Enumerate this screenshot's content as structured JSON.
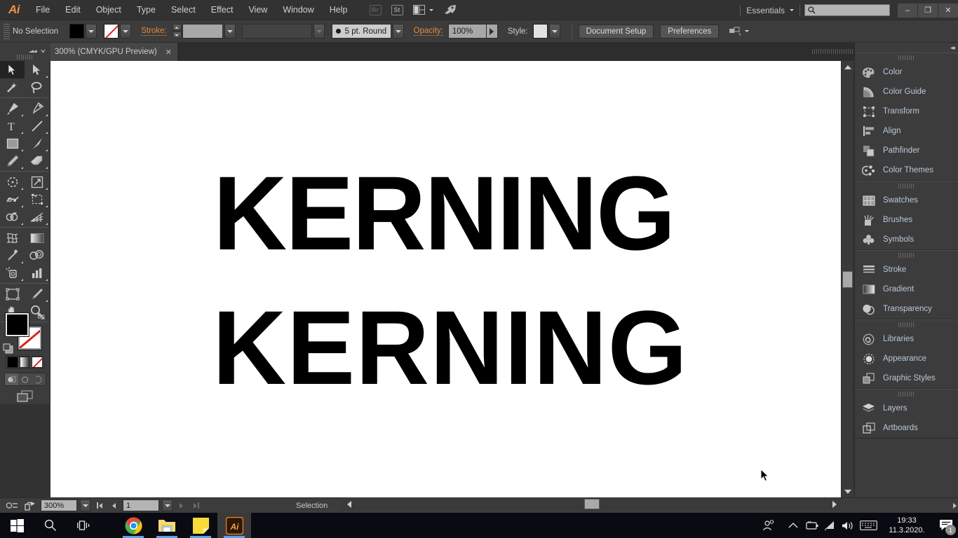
{
  "app": {
    "name": "Adobe Illustrator",
    "logo_text": "Ai",
    "accent_orange": "#e08b3e",
    "dock_label_color": "#b9c8d8"
  },
  "menubar": {
    "items": [
      "File",
      "Edit",
      "Object",
      "Type",
      "Select",
      "Effect",
      "View",
      "Window",
      "Help"
    ],
    "icons": [
      {
        "name": "bridge-icon",
        "label": "Br"
      },
      {
        "name": "stock-icon",
        "label": "St"
      },
      {
        "name": "arrange-documents-icon",
        "label": ""
      },
      {
        "name": "rocket-icon",
        "label": ""
      }
    ],
    "workspace": "Essentials",
    "search_placeholder": "",
    "window_buttons": {
      "minimize": "–",
      "restore": "❐",
      "close": "✕"
    }
  },
  "controlbar": {
    "selection_status": "No Selection",
    "fill_swatch": "#000000",
    "stroke_swatch": "none",
    "stroke_label": "Stroke:",
    "stroke_weight": "",
    "stroke_profile": "",
    "brush_definition": "5 pt. Round",
    "opacity_label": "Opacity:",
    "opacity_value": "100%",
    "style_label": "Style:",
    "document_setup_label": "Document Setup",
    "preferences_label": "Preferences"
  },
  "tabbar": {
    "document_title": "300% (CMYK/GPU Preview)",
    "close_glyph": "✕",
    "collapse_glyph": "◀◀"
  },
  "toolbar": {
    "tools": [
      {
        "name": "selection-tool",
        "active": true,
        "has_flyout": false
      },
      {
        "name": "direct-selection-tool",
        "active": false,
        "has_flyout": true
      },
      {
        "name": "magic-wand-tool",
        "active": false,
        "has_flyout": false
      },
      {
        "name": "lasso-tool",
        "active": false,
        "has_flyout": false
      },
      {
        "name": "pen-tool",
        "active": false,
        "has_flyout": true
      },
      {
        "name": "curvature-tool",
        "active": false,
        "has_flyout": false
      },
      {
        "name": "type-tool",
        "active": false,
        "has_flyout": true
      },
      {
        "name": "line-segment-tool",
        "active": false,
        "has_flyout": true
      },
      {
        "name": "rectangle-tool",
        "active": false,
        "has_flyout": true
      },
      {
        "name": "paintbrush-tool",
        "active": false,
        "has_flyout": true
      },
      {
        "name": "pencil-tool",
        "active": false,
        "has_flyout": true
      },
      {
        "name": "eraser-tool",
        "active": false,
        "has_flyout": true
      },
      {
        "name": "rotate-tool",
        "active": false,
        "has_flyout": true
      },
      {
        "name": "scale-tool",
        "active": false,
        "has_flyout": true
      },
      {
        "name": "width-tool",
        "active": false,
        "has_flyout": true
      },
      {
        "name": "free-transform-tool",
        "active": false,
        "has_flyout": false
      },
      {
        "name": "shape-builder-tool",
        "active": false,
        "has_flyout": true
      },
      {
        "name": "perspective-grid-tool",
        "active": false,
        "has_flyout": true
      },
      {
        "name": "mesh-tool",
        "active": false,
        "has_flyout": false
      },
      {
        "name": "gradient-tool",
        "active": false,
        "has_flyout": false
      },
      {
        "name": "eyedropper-tool",
        "active": false,
        "has_flyout": true
      },
      {
        "name": "blend-tool",
        "active": false,
        "has_flyout": false
      },
      {
        "name": "symbol-sprayer-tool",
        "active": false,
        "has_flyout": true
      },
      {
        "name": "column-graph-tool",
        "active": false,
        "has_flyout": true
      },
      {
        "name": "artboard-tool",
        "active": false,
        "has_flyout": false
      },
      {
        "name": "slice-tool",
        "active": false,
        "has_flyout": true
      },
      {
        "name": "hand-tool",
        "active": false,
        "has_flyout": true
      },
      {
        "name": "zoom-tool",
        "active": false,
        "has_flyout": false
      }
    ],
    "fill_color": "#000000",
    "stroke_color": "none",
    "mini_swatches": [
      "#000000",
      "gradient",
      "none"
    ],
    "draw_modes": [
      "draw-normal",
      "draw-behind",
      "draw-inside"
    ],
    "active_draw_mode": "draw-normal",
    "screen_mode": "change-screen-mode"
  },
  "canvas": {
    "text_lines": [
      {
        "id": "line-1",
        "text": "KERNING",
        "tracking": "tight"
      },
      {
        "id": "line-2",
        "text": "KERNING",
        "tracking": "loose"
      }
    ],
    "background": "#ffffff",
    "artwork_color": "#000000"
  },
  "statusbar": {
    "zoom_level": "300%",
    "page_number": "1",
    "current_tool": "Selection"
  },
  "dock": {
    "groups": [
      {
        "name": "color-group",
        "panels": [
          {
            "label": "Color",
            "icon": "color-palette-icon"
          },
          {
            "label": "Color Guide",
            "icon": "color-guide-icon"
          },
          {
            "label": "Transform",
            "icon": "transform-icon"
          },
          {
            "label": "Align",
            "icon": "align-icon"
          },
          {
            "label": "Pathfinder",
            "icon": "pathfinder-icon"
          },
          {
            "label": "Color Themes",
            "icon": "color-themes-icon"
          }
        ]
      },
      {
        "name": "assets-group",
        "panels": [
          {
            "label": "Swatches",
            "icon": "swatches-icon"
          },
          {
            "label": "Brushes",
            "icon": "brushes-icon"
          },
          {
            "label": "Symbols",
            "icon": "symbols-icon"
          }
        ]
      },
      {
        "name": "appearance-group",
        "panels": [
          {
            "label": "Stroke",
            "icon": "stroke-icon"
          },
          {
            "label": "Gradient",
            "icon": "gradient-icon"
          },
          {
            "label": "Transparency",
            "icon": "transparency-icon"
          }
        ]
      },
      {
        "name": "libraries-group",
        "panels": [
          {
            "label": "Libraries",
            "icon": "libraries-icon"
          },
          {
            "label": "Appearance",
            "icon": "appearance-icon"
          },
          {
            "label": "Graphic Styles",
            "icon": "graphic-styles-icon"
          }
        ]
      },
      {
        "name": "layers-group",
        "panels": [
          {
            "label": "Layers",
            "icon": "layers-icon"
          },
          {
            "label": "Artboards",
            "icon": "artboards-icon"
          }
        ]
      }
    ]
  },
  "taskbar": {
    "buttons": [
      {
        "name": "start-button",
        "icon": "windows-logo-icon"
      },
      {
        "name": "search-button",
        "icon": "magnifier-icon"
      },
      {
        "name": "task-view-button",
        "icon": "task-view-icon"
      }
    ],
    "apps": [
      {
        "name": "chrome",
        "icon": "chrome-icon",
        "running": true,
        "active": false
      },
      {
        "name": "file-explorer",
        "icon": "folder-icon",
        "running": true,
        "active": false
      },
      {
        "name": "sticky-notes",
        "icon": "sticky-note-icon",
        "running": true,
        "active": false
      },
      {
        "name": "illustrator",
        "icon": "illustrator-icon",
        "running": true,
        "active": true
      }
    ],
    "tray_icons": [
      "people-icon",
      "show-hidden-icons-chevron",
      "battery-icon",
      "wifi-icon",
      "volume-icon",
      "keyboard-icon"
    ],
    "clock_time": "19:33",
    "clock_date": "11.3.2020.",
    "notification_count": "1"
  }
}
